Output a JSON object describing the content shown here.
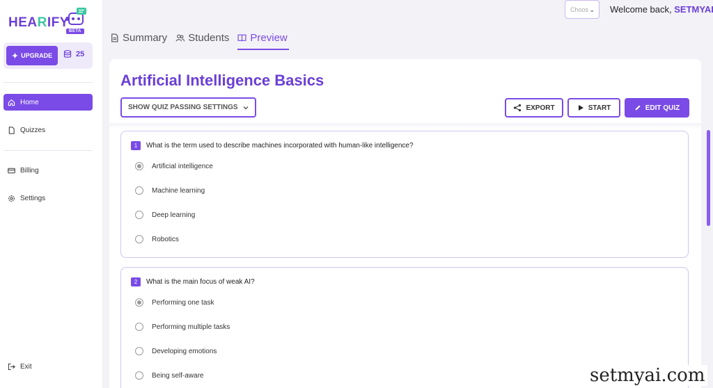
{
  "brand": {
    "name_pre": "HEA",
    "name_hl": "R",
    "name_post": "IFY",
    "badge": "BETA"
  },
  "sidebar": {
    "upgrade_label": "UPGRADE",
    "credits": "25",
    "items": [
      {
        "label": "Home",
        "icon": "home-icon",
        "active": true
      },
      {
        "label": "Quizzes",
        "icon": "document-icon"
      },
      {
        "label": "Billing",
        "icon": "credit-card-icon"
      },
      {
        "label": "Settings",
        "icon": "gear-icon"
      }
    ],
    "exit_label": "Exit"
  },
  "header": {
    "select_placeholder": "Choos",
    "welcome_text": "Welcome back,",
    "username": "SETMYAI"
  },
  "tabs": [
    {
      "label": "Summary",
      "icon": "document-icon"
    },
    {
      "label": "Students",
      "icon": "users-icon"
    },
    {
      "label": "Preview",
      "icon": "book-icon",
      "active": true
    }
  ],
  "quiz": {
    "title": "Artificial Intelligence Basics",
    "passing_settings_label": "SHOW QUIZ PASSING SETTINGS",
    "export_label": "EXPORT",
    "start_label": "START",
    "edit_label": "EDIT QUIZ",
    "questions": [
      {
        "number": "1",
        "text": "What is the term used to describe machines incorporated with human-like intelligence?",
        "options": [
          "Artificial intelligence",
          "Machine learning",
          "Deep learning",
          "Robotics"
        ],
        "selected": 0
      },
      {
        "number": "2",
        "text": "What is the main focus of weak AI?",
        "options": [
          "Performing one task",
          "Performing multiple tasks",
          "Developing emotions",
          "Being self-aware"
        ],
        "selected": 0
      }
    ]
  },
  "watermark": "setmyai.com",
  "colors": {
    "accent": "#7a4be6",
    "accent_text": "#6a3fd6",
    "brand_green": "#3cc8a2"
  }
}
